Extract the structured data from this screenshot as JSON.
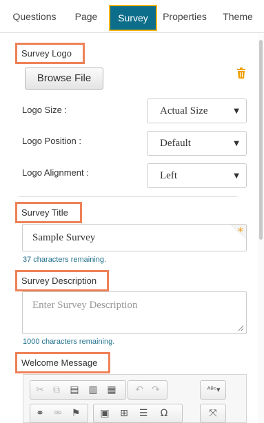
{
  "tabs": [
    {
      "label": "Questions"
    },
    {
      "label": "Page"
    },
    {
      "label": "Survey"
    },
    {
      "label": "Properties"
    },
    {
      "label": "Theme"
    }
  ],
  "active_tab": "Survey",
  "logo": {
    "section_label": "Survey Logo",
    "browse_label": "Browse File",
    "delete_icon": "trash-icon",
    "size_label": "Logo Size :",
    "size_value": "Actual Size",
    "position_label": "Logo Position :",
    "position_value": "Default",
    "alignment_label": "Logo Alignment :",
    "alignment_value": "Left"
  },
  "title": {
    "section_label": "Survey Title",
    "value": "Sample Survey",
    "required_marker": "*",
    "remaining": "37 characters remaining."
  },
  "description": {
    "section_label": "Survey Description",
    "placeholder": "Enter Survey Description",
    "remaining": "1000 characters remaining."
  },
  "welcome": {
    "section_label": "Welcome Message"
  },
  "colors": {
    "active_tab_bg": "#0c6e8a",
    "active_tab_border": "#f0b400",
    "highlight_border": "#ee8157",
    "hint_text": "#1f6f8b",
    "required_star": "#f0a020",
    "trash_icon": "#f0a000"
  }
}
